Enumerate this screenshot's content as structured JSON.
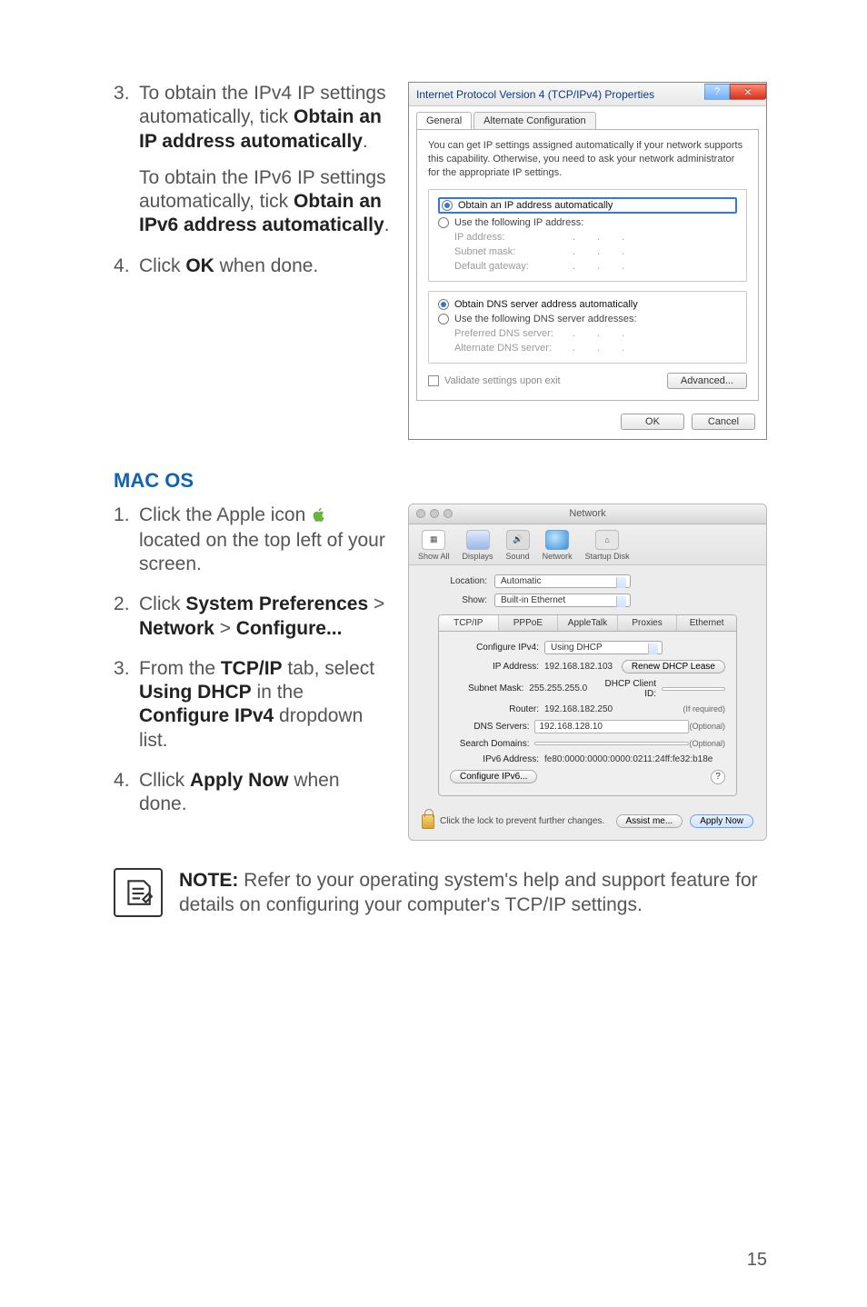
{
  "steps_win": {
    "s3": {
      "p1_a": "To obtain the IPv4 IP settings automatically, tick ",
      "p1_b": "Obtain an IP address automatically",
      "p1_c": ".",
      "p2_a": "To obtain the IPv6 IP settings automatically, tick ",
      "p2_b": "Obtain an IPv6 address automatically",
      "p2_c": "."
    },
    "s4": {
      "a": "Click ",
      "b": "OK",
      "c": " when done."
    }
  },
  "win_dialog": {
    "title": "Internet Protocol Version 4 (TCP/IPv4) Properties",
    "help": "?",
    "close": "✕",
    "tab_general": "General",
    "tab_alt": "Alternate Configuration",
    "desc": "You can get IP settings assigned automatically if your network supports this capability. Otherwise, you need to ask your network administrator for the appropriate IP settings.",
    "r_obtain_ip": "Obtain an IP address automatically",
    "r_use_ip": "Use the following IP address:",
    "k_ip": "IP address:",
    "k_subnet": "Subnet mask:",
    "k_gw": "Default gateway:",
    "r_obtain_dns": "Obtain DNS server address automatically",
    "r_use_dns": "Use the following DNS server addresses:",
    "k_pref_dns": "Preferred DNS server:",
    "k_alt_dns": "Alternate DNS server:",
    "chk_validate": "Validate settings upon exit",
    "btn_advanced": "Advanced...",
    "btn_ok": "OK",
    "btn_cancel": "Cancel",
    "dots": "."
  },
  "mac_heading": "MAC OS",
  "steps_mac": {
    "s1": {
      "a": "Click the Apple icon ",
      "b": " located on the top left of your screen."
    },
    "s2": {
      "a": "Click ",
      "b": "System Preferences",
      "c": " > ",
      "d": "Network",
      "e": " > ",
      "f": "Configure..."
    },
    "s3": {
      "a": "From the ",
      "b": "TCP/IP",
      "c": " tab, select ",
      "d": "Using DHCP",
      "e": " in the ",
      "f": "Configure IPv4",
      "g": " dropdown list."
    },
    "s4": {
      "a": "Cllick ",
      "b": "Apply Now",
      "c": " when done."
    }
  },
  "mac_window": {
    "title": "Network",
    "tb": {
      "showall": "Show All",
      "displays": "Displays",
      "sound": "Sound",
      "network": "Network",
      "startup": "Startup Disk"
    },
    "location_lbl": "Location:",
    "location_val": "Automatic",
    "show_lbl": "Show:",
    "show_val": "Built-in Ethernet",
    "tabs": {
      "tcpip": "TCP/IP",
      "pppoe": "PPPoE",
      "atalk": "AppleTalk",
      "proxies": "Proxies",
      "ethernet": "Ethernet"
    },
    "configure_lbl": "Configure IPv4:",
    "configure_val": "Using DHCP",
    "ip_lbl": "IP Address:",
    "ip_val": "192.168.182.103",
    "renew_btn": "Renew DHCP Lease",
    "subnet_lbl": "Subnet Mask:",
    "subnet_val": "255.255.255.0",
    "dhcp_id_lbl": "DHCP Client ID:",
    "dhcp_id_hint": "(If required)",
    "router_lbl": "Router:",
    "router_val": "192.168.182.250",
    "dns_lbl": "DNS Servers:",
    "dns_val": "192.168.128.10",
    "optional": "(Optional)",
    "search_lbl": "Search Domains:",
    "ipv6_lbl": "IPv6 Address:",
    "ipv6_val": "fe80:0000:0000:0000:0211:24ff:fe32:b18e",
    "cfg_ipv6_btn": "Configure IPv6...",
    "help_btn": "?",
    "lock_text": "Click the lock to prevent further changes.",
    "assist_btn": "Assist me...",
    "apply_btn": "Apply Now"
  },
  "note": {
    "label": "NOTE:",
    "text": " Refer to your operating system's help and support feature for details on configuring your computer's TCP/IP settings."
  },
  "page_number": "15"
}
